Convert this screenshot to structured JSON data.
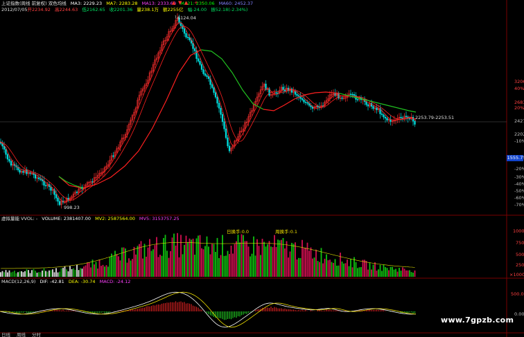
{
  "header": {
    "title": "上证指数(周线 前复权) 双色均线",
    "ma3": "MA3: 2229.23",
    "ma7": "MA7: 2283.28",
    "ma13": "MA13: 2333.60",
    "ma21": "MA21: 2350.06",
    "ma60": "MA60: 2452.37",
    "info_date": "2012/07/05",
    "info_open": "开2234.92",
    "info_high": "高2244.63",
    "info_low": "低2162.65",
    "info_close": "收2201.36",
    "info_vol": "量238.1万",
    "info_amount": "额2255亿",
    "info_change": "幅-24.00",
    "info_pct": "振52.18(-2.34%)"
  },
  "annotations": {
    "peak": "6124.04",
    "trough": "998.23",
    "current_range": "2253.79-2253.51",
    "turnover1": "日换手:0.0",
    "turnover2": "周换手:0.1"
  },
  "price_axis": [
    {
      "label": "3206",
      "color": "#ff4040"
    },
    {
      "label": "40%",
      "color": "#ff4040"
    },
    {
      "label": "2683",
      "color": "#ff4040"
    },
    {
      "label": "20%",
      "color": "#ff4040"
    },
    {
      "label": "2427",
      "color": "#c0c0c0"
    },
    {
      "label": "2202",
      "color": "#c0c0c0"
    },
    {
      "label": "-10%",
      "color": "#c0c0c0"
    },
    {
      "label": "1555",
      "color": "#c0c0c0"
    },
    {
      "label": "-20%",
      "color": "#c0c0c0"
    },
    {
      "label": "-30%",
      "color": "#c0c0c0"
    },
    {
      "label": "-40%",
      "color": "#c0c0c0"
    },
    {
      "label": "-50%",
      "color": "#c0c0c0"
    },
    {
      "label": "-60%",
      "color": "#c0c0c0"
    },
    {
      "label": "-70%",
      "color": "#c0c0c0"
    }
  ],
  "price_box": "1555.7",
  "volume": {
    "title": "虚拟量能 VVOL: -",
    "vol": "VOLUME: 2381407.00",
    "mv2": "MV2: 2587564.00",
    "mv5": "MV5: 3153757.25",
    "axis": [
      "10000",
      "7500",
      "5000",
      "2500",
      "×10000"
    ]
  },
  "macd": {
    "title": "MACD(12,26,9)",
    "dif": "DIF: -42.81",
    "dea": "DEA: -30.74",
    "macd": "MACD: -24.12",
    "axis": [
      "500.00",
      "0.00"
    ]
  },
  "bottom_tabs": [
    "日线",
    "周线",
    "分时"
  ],
  "watermark": "www.7gpzb.com",
  "colors": {
    "up": "#ff3030",
    "down": "#00e0e0",
    "ma_red": "#ff2020",
    "ma_green": "#20c020",
    "vol_up": "#d01050",
    "vol_down": "#10c010",
    "dif": "#ffffff",
    "dea": "#f0e000"
  }
}
